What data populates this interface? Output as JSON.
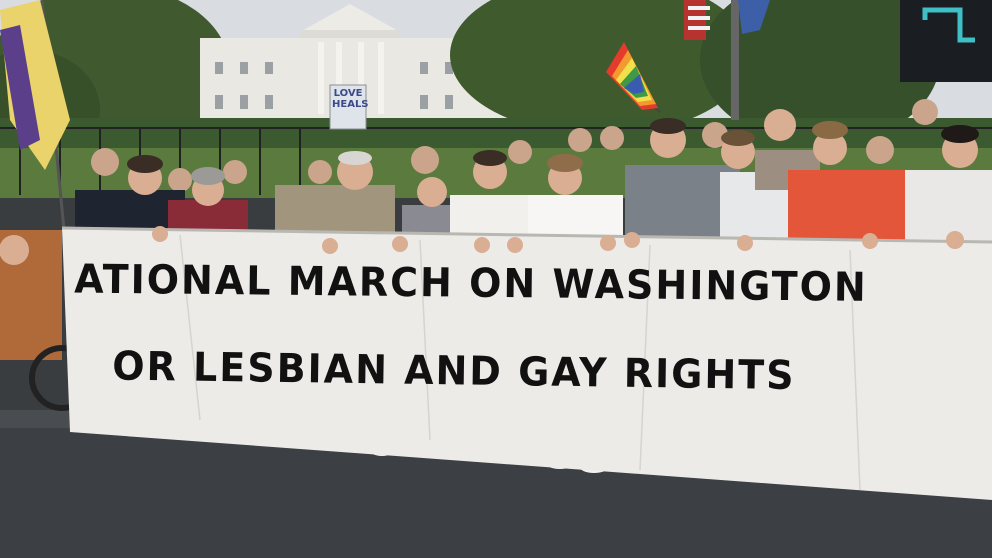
{
  "banner": {
    "line1": "ATIONAL MARCH ON WASHINGTON",
    "line2": "OR LESBIAN AND GAY RIGHTS"
  },
  "sign": {
    "text": "LOVE HEALS"
  },
  "colors": {
    "sky": "#d9dde2",
    "white_house": "#e9e8e2",
    "trees": "#3f5a2d",
    "asphalt": "#3c3f43",
    "banner_cloth": "#ecebe8",
    "banner_ink": "#111111",
    "red_shirt": "#e4563a"
  }
}
